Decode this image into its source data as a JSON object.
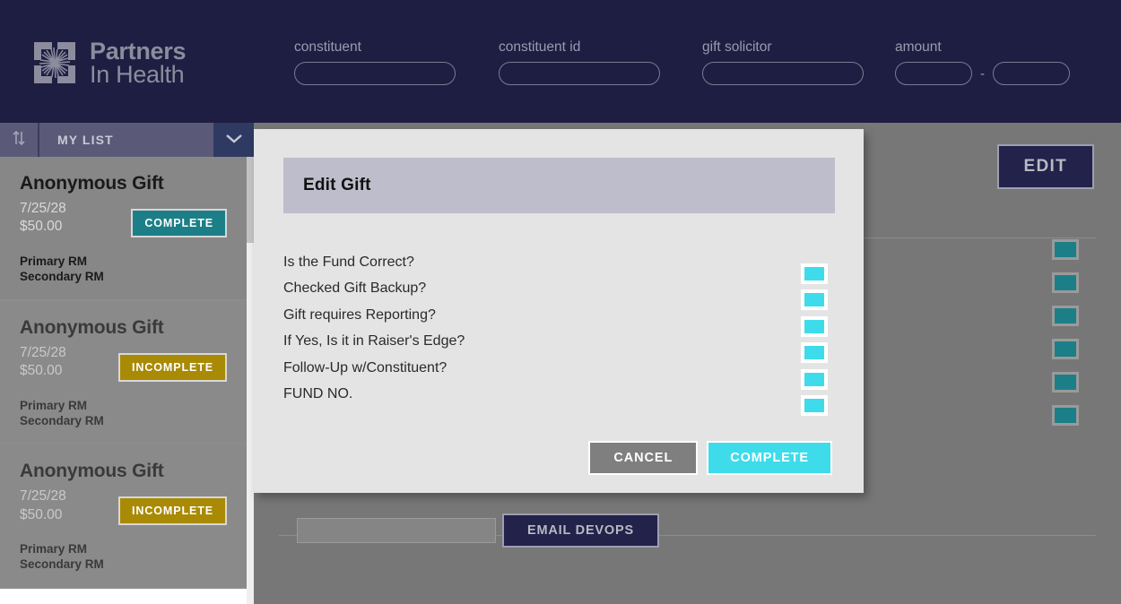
{
  "brand": {
    "line1": "Partners",
    "line2": "In Health",
    "logo_icon": "pih-hands-logo-icon",
    "color": "#8c8c9e"
  },
  "header": {
    "background": "#1e1e42",
    "filters": [
      {
        "label": "constituent",
        "value": "",
        "placeholder": "",
        "name": "constituent"
      },
      {
        "label": "constituent id",
        "value": "",
        "placeholder": "",
        "name": "constituent-id"
      },
      {
        "label": "gift solicitor",
        "value": "",
        "placeholder": "",
        "name": "gift-solicitor"
      }
    ],
    "amount": {
      "label": "amount",
      "min_value": "",
      "max_value": "",
      "separator": "-"
    }
  },
  "list_toolbar": {
    "sort_icon": "sort-up-down-icon",
    "title": "MY LIST",
    "dropdown_icon": "chevron-down-icon"
  },
  "gift_cards": [
    {
      "title": "Anonymous Gift",
      "date": "7/25/28",
      "amount": "$50.00",
      "status": "COMPLETE",
      "status_color": "#1c7f88",
      "primary_rm": "Primary RM",
      "secondary_rm": "Secondary RM",
      "selected": true
    },
    {
      "title": "Anonymous Gift",
      "date": "7/25/28",
      "amount": "$50.00",
      "status": "INCOMPLETE",
      "status_color": "#a98a05",
      "primary_rm": "Primary RM",
      "secondary_rm": "Secondary RM",
      "selected": false
    },
    {
      "title": "Anonymous Gift",
      "date": "7/25/28",
      "amount": "$50.00",
      "status": "INCOMPLETE",
      "status_color": "#a98a05",
      "primary_rm": "Primary RM",
      "secondary_rm": "Secondary RM",
      "selected": false
    }
  ],
  "main": {
    "edit_label": "EDIT",
    "edit_color": "#22224a",
    "row_checkbox_count": 6,
    "row_checkbox_color": "#1c7f88",
    "devops": {
      "input_value": "",
      "input_placeholder": "",
      "button_label": "EMAIL DEVOPS"
    }
  },
  "modal": {
    "title": "Edit Gift",
    "titlebar_color": "#bdbdcb",
    "background": "#e4e4e4",
    "checkbox_color": "#3edcea",
    "items": [
      {
        "label": "Is the Fund Correct?",
        "checked": true
      },
      {
        "label": "Checked Gift Backup?",
        "checked": true
      },
      {
        "label": "Gift requires Reporting?",
        "checked": true
      },
      {
        "label": "If Yes, Is it in Raiser's Edge?",
        "checked": true
      },
      {
        "label": "Follow-Up w/Constituent?",
        "checked": true
      },
      {
        "label": "FUND NO.",
        "checked": true
      }
    ],
    "cancel_label": "CANCEL",
    "complete_label": "COMPLETE",
    "cancel_color": "#7f7f7f",
    "complete_color": "#3edcea"
  }
}
